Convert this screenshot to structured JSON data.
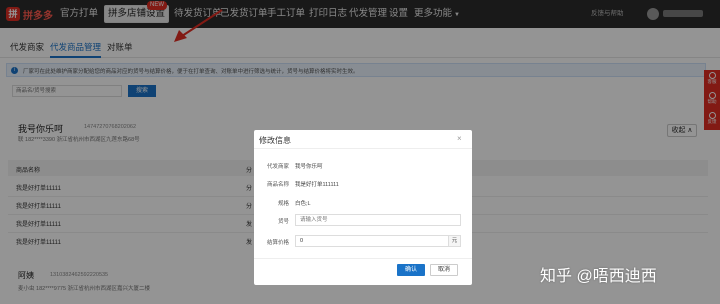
{
  "nav": {
    "logo": "拼多多",
    "items": [
      "官方打单",
      "拼多店铺设置",
      "待发货订单",
      "已发货订单",
      "手工订单",
      "打印日志",
      "代发管理",
      "设置",
      "更多功能"
    ],
    "new_badge": "NEW",
    "help": "反馈与帮助"
  },
  "subtabs": [
    "代发商家",
    "代发商品管理",
    "对账单"
  ],
  "notice": "厂家可在此处维护商家分配给您的商品对应的货号与结算价格，便于在打单查询、对账单中进行筛选与统计，货号与结算价格将实时生效。",
  "search": {
    "placeholder": "商品名/货号搜索",
    "button": "搜索"
  },
  "merchant1": {
    "name": "我号你乐呵",
    "id": "14747270768202062",
    "sub": "联 182****3390   浙江省杭州市西湖区九莲东路68号"
  },
  "collapse": "收起",
  "table": {
    "header": "商品名称",
    "header_right": "分",
    "rows": [
      {
        "name": "我是好打单11111",
        "right": "分"
      },
      {
        "name": "我是好打单11111",
        "right": "分"
      },
      {
        "name": "我是好打单11111",
        "right": "发"
      },
      {
        "name": "我是好打单11111",
        "right": "发"
      }
    ]
  },
  "merchant2": {
    "name": "阿姨",
    "id": "1310382462592220535",
    "sub": "麦小虫   182****9775   浙江省杭州市西湖区嘉兴大厦二楼"
  },
  "rail": [
    "客服",
    "帮助",
    "反馈"
  ],
  "modal": {
    "title": "修改信息",
    "fields": {
      "merchant_label": "代发商家",
      "merchant_value": "我号你乐呵",
      "product_label": "商品名称",
      "product_value": "我是好打单111111",
      "spec_label": "规格",
      "spec_value": "白色;L",
      "sku_label": "货号",
      "sku_placeholder": "请输入货号",
      "price_label": "结算价格",
      "price_value": "0",
      "price_unit": "元"
    },
    "ok": "确认",
    "cancel": "取消"
  },
  "watermark": "知乎 @唔西迪西"
}
